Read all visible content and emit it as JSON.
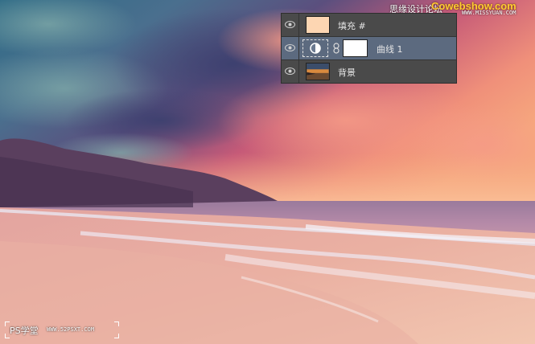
{
  "layers_panel": {
    "layers": [
      {
        "name": "填充 #",
        "thumb_color": "#fdd6b2",
        "selected": false,
        "visible": true
      },
      {
        "name": "曲线 1",
        "thumb_color": "#ffffff",
        "selected": true,
        "visible": true
      },
      {
        "name": "背景",
        "selected": false,
        "visible": true
      }
    ],
    "panel_color": "#4a4a4a",
    "selected_row_color": "#5c6a7f",
    "icons": [
      "eye-icon",
      "curves-adjustment-icon",
      "chain-link-icon"
    ]
  },
  "watermarks": {
    "top_cn": "思缘设计论坛",
    "top_brand": "Cowebshow.com",
    "top_url": "WWW.MISSYUAN.COM",
    "bottom_ps": "PS学堂",
    "bottom_url": "WWW.52PSXT.COM"
  }
}
